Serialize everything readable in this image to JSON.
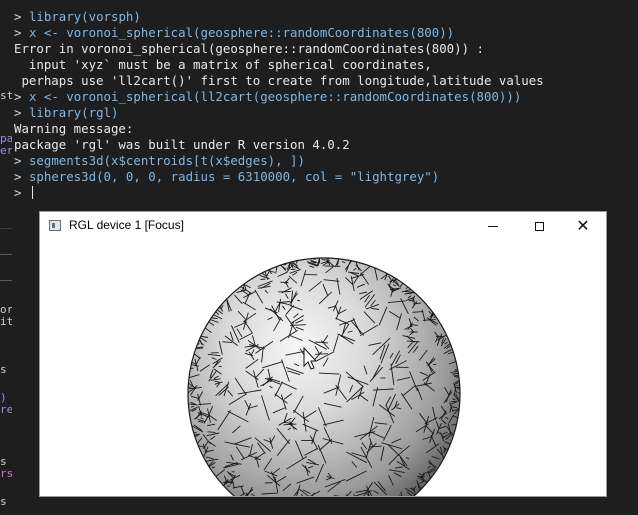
{
  "console": {
    "prompt": ">",
    "lines": [
      {
        "type": "cmd",
        "text": "library(vorsph)"
      },
      {
        "type": "cmd",
        "text": "x <- voronoi_spherical(geosphere::randomCoordinates(800))"
      },
      {
        "type": "out",
        "text": "Error in voronoi_spherical(geosphere::randomCoordinates(800)) :"
      },
      {
        "type": "out",
        "text": "  input 'xyz` must be a matrix of spherical coordinates,"
      },
      {
        "type": "out",
        "text": " perhaps use 'll2cart()' first to create from longitude,latitude values"
      },
      {
        "type": "cmd",
        "text": "x <- voronoi_spherical(ll2cart(geosphere::randomCoordinates(800)))"
      },
      {
        "type": "cmd",
        "text": "library(rgl)"
      },
      {
        "type": "out",
        "text": "Warning message:"
      },
      {
        "type": "out",
        "text": "package 'rgl' was built under R version 4.0.2"
      },
      {
        "type": "cmd",
        "text": "segments3d(x$centroids[t(x$edges), ])"
      },
      {
        "type": "cmd",
        "text": "spheres3d(0, 0, 0, radius = 6310000, col = \"lightgrey\")"
      },
      {
        "type": "cmd",
        "text": ""
      }
    ]
  },
  "left_strip": [
    {
      "text": "st",
      "color": "#cfcfcf"
    },
    {
      "text": "pa",
      "color": "#9b8fd6"
    },
    {
      "text": "er",
      "color": "#9b8fd6"
    },
    {
      "text": "or",
      "color": "#cfcfcf"
    },
    {
      "text": "it",
      "color": "#cfcfcf"
    },
    {
      "text": "s",
      "color": "#cfcfcf"
    },
    {
      "text": ")",
      "color": "#9b8fd6"
    },
    {
      "text": "re",
      "color": "#9b8fd6"
    },
    {
      "text": "s",
      "color": "#cfcfcf"
    },
    {
      "text": "rs",
      "color": "#c678c6"
    },
    {
      "text": "s",
      "color": "#cfcfcf"
    }
  ],
  "rgl_window": {
    "title": "RGL device 1 [Focus]",
    "icons": {
      "app": "rgl-window-icon",
      "minimize": "minimize-icon",
      "maximize": "maximize-icon",
      "close": "close-icon",
      "pointer": "mouse-pointer-icon"
    },
    "close_glyph": "✕"
  },
  "colors": {
    "console_bg": "#1e1e1e",
    "command": "#7fb6e6",
    "output": "#e8e8e8",
    "sphere_light": "#f4f4f4",
    "sphere_dark": "#4a4a4a",
    "edges": "#1a1a1a"
  }
}
